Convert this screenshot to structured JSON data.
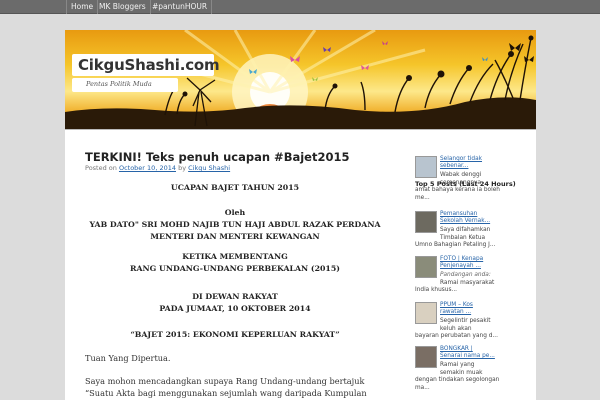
{
  "nav": {
    "items": [
      "Home",
      "MK Bloggers",
      "#pantunHOUR"
    ]
  },
  "site": {
    "title": "CikguShashi.com",
    "tagline": "Pentas Politik Muda"
  },
  "post": {
    "title": "TERKINI! Teks penuh ucapan #Bajet2015",
    "meta_prefix": "Posted on",
    "date": "October 10, 2014",
    "meta_by": "by",
    "author": "Cikgu Shashi",
    "heading_lines": [
      "UCAPAN BAJET TAHUN 2015",
      "Oleh",
      "YAB DATO\" SRI MOHD NAJIB TUN HAJI ABDUL RAZAK PERDANA",
      "MENTERI DAN MENTERI KEWANGAN",
      "KETIKA MEMBENTANG",
      "RANG UNDANG-UNDANG PERBEKALAN (2015)",
      "DI DEWAN RAKYAT",
      "PADA JUMAAT, 10 OKTOBER 2014",
      "“BAJET 2015: EKONOMI KEPERLUAN RAKYAT”"
    ],
    "salutation": "Tuan Yang Dipertua.",
    "para_lines": [
      "Saya mohon mencadangkan supaya Rang Undang-undang bertajuk",
      "“Suatu Akta bagi menggunakan sejumlah wang daripada Kumpulan"
    ]
  },
  "sidebar": {
    "title": "Top 5 Posts (Last 24 Hours)",
    "posts": [
      {
        "link_lines": [
          "Selangor tidak",
          "sebenar..."
        ],
        "excerpt_lines": [
          "Wabak denggi",
          "semenangnya",
          "amat bahaya kerana ia boleh",
          "me..."
        ],
        "thumb_color": "#b8c4cf"
      },
      {
        "link_lines": [
          "Pemansuhan",
          "Sekolah Vernak..."
        ],
        "excerpt_lines": [
          "Saya difahamkan",
          "Timbalan Ketua",
          "Umno Bahagian Petaling J..."
        ],
        "thumb_color": "#6d6a60"
      },
      {
        "link_lines": [
          "FOTO | Kenapa",
          "Penjenayah ..."
        ],
        "excerpt_lines": [
          "Pandangan anda:",
          "Ramai masyarakat",
          "India khusus..."
        ],
        "thumb_color": "#8a8c7a"
      },
      {
        "link_lines": [
          "PPUM – Kos",
          "rawatan ..."
        ],
        "excerpt_lines": [
          "Segelintir pesakit",
          "keluh akan",
          "bayaran perubatan yang d..."
        ],
        "thumb_color": "#d9d0c0"
      },
      {
        "link_lines": [
          "BONGKAR |",
          "Senarai nama pe..."
        ],
        "excerpt_lines": [
          "Ramai yang",
          "semakin muak",
          "dengan tindakan segolongan",
          "ma..."
        ],
        "thumb_color": "#7a6e64"
      }
    ]
  },
  "colors": {
    "link": "#2764a8",
    "nav_bg": "#6b6b6b",
    "page_bg": "#dcdcdc",
    "banner_sky": "#f5c52a"
  }
}
